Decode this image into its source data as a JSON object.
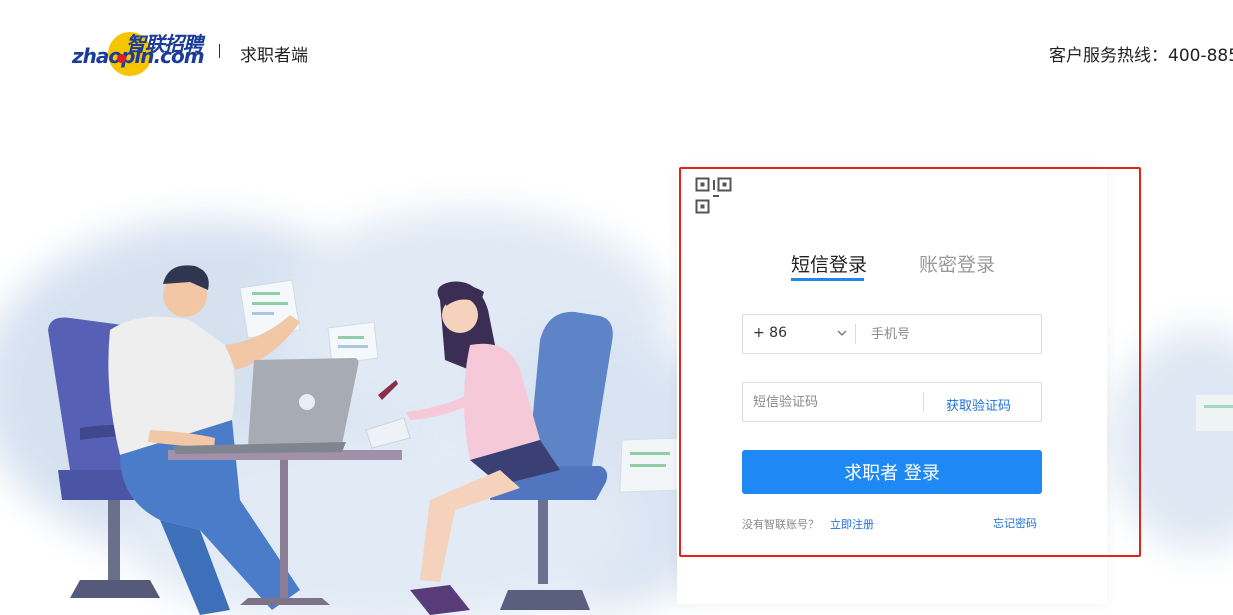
{
  "header": {
    "logo_cn": "智联招聘",
    "logo_en": "zhaopin.com",
    "portal_label": "求职者端",
    "hotline": "客户服务热线：400-885"
  },
  "login": {
    "tabs": [
      {
        "label": "短信登录",
        "active": true
      },
      {
        "label": "账密登录",
        "active": false
      }
    ],
    "country_code": "+ 86",
    "phone_placeholder": "手机号",
    "code_placeholder": "短信验证码",
    "get_code_label": "获取验证码",
    "submit_label": "求职者 登录",
    "no_account_text": "没有智联账号？",
    "register_label": "立即注册",
    "forgot_label": "忘记密码"
  },
  "colors": {
    "accent": "#1e88f5",
    "link": "#1e6fd9",
    "highlight": "#e0241b",
    "logo_blue": "#1a3c9a",
    "logo_yellow": "#f6c500"
  }
}
